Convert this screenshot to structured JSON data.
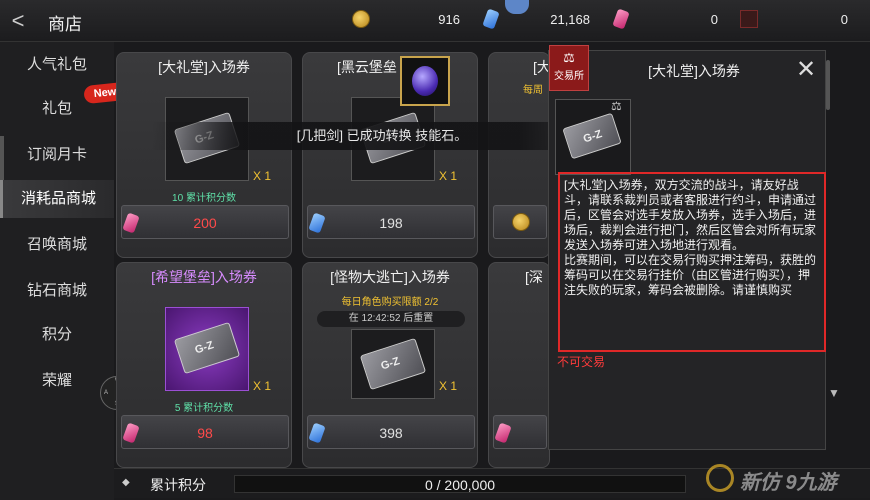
{
  "header": {
    "title": "商店",
    "currencies": [
      {
        "icon": "gold-coin-icon",
        "value": "916"
      },
      {
        "icon": "blue-gem-icon",
        "value": "21,168"
      },
      {
        "icon": "pink-gem-icon",
        "value": "0"
      },
      {
        "icon": "token-icon",
        "value": "0"
      }
    ]
  },
  "sidebar": {
    "items": [
      {
        "label": "人气礼包"
      },
      {
        "label": "礼包"
      },
      {
        "label": "订阅月卡"
      },
      {
        "label": "消耗品商城"
      },
      {
        "label": "召唤商城"
      },
      {
        "label": "钻石商城"
      },
      {
        "label": "积分"
      },
      {
        "label": "荣耀"
      }
    ],
    "new_badge": "New",
    "compass": [
      "W",
      "A",
      "D",
      "S"
    ]
  },
  "cards": [
    {
      "title": "[大礼堂]入场券",
      "qty": "X 1",
      "points": "10 累计积分数",
      "price": "200",
      "price_color": "#ff4a4a",
      "currency": "pink"
    },
    {
      "title": "[黑云堡垒",
      "qty": "X 1",
      "price": "198",
      "currency": "blue"
    },
    {
      "title": "[大",
      "sub": "每周",
      "currency": "gold"
    },
    {
      "title": "[希望堡垒]入场券",
      "qty": "X 1",
      "points": "5 累计积分数",
      "price": "98",
      "price_color": "#ff4a4a",
      "currency": "pink"
    },
    {
      "title": "[怪物大逃亡]入场券",
      "sub": "每日角色购买限额 2/2",
      "timer": "在 12:42:52 后重置",
      "qty": "X 1",
      "price": "398",
      "currency": "blue"
    },
    {
      "title": "[深",
      "currency": "pink"
    }
  ],
  "toast": "[几把剑] 已成功转换 技能石。",
  "info_panel": {
    "tag": "交易所",
    "title": "[大礼堂]入场券",
    "close": "✕",
    "description": [
      "[大礼堂]入场券，双方交流的战斗，请友好战斗，请联系裁判员或者客服进行约斗，申请通过后，区管会对选手发放入场券，选手入场后，进场后，裁判会进行把门，然后区管会对所有玩家发送入场券可进入场地进行观看。",
      "比赛期间，可以在交易行购买押注筹码，获胜的筹码可以在交易行挂价（由区管进行购买），押注失败的玩家，筹码会被删除。请谨慎购买"
    ],
    "not_tradable": "不可交易"
  },
  "bottom": {
    "label": "累计积分",
    "progress_text": "0 / 200,000",
    "progress_fraction": 0
  },
  "watermark": "新仿 9九游",
  "colors": {
    "accent_red": "#e02828",
    "gold": "#f1c232",
    "green": "#5fe0a8"
  }
}
